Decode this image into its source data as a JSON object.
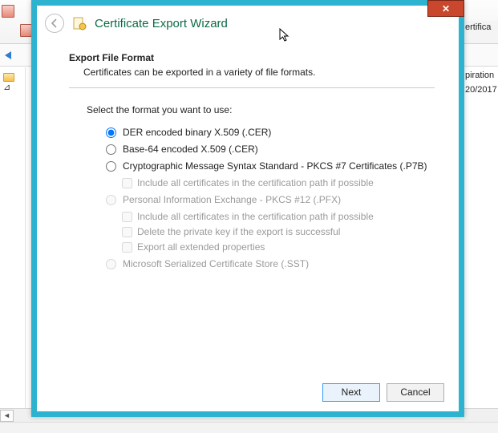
{
  "background": {
    "column_header": "ertifica",
    "column_header2": "piration",
    "date_cell": "20/2017",
    "tree_marker": "⊿"
  },
  "wizard": {
    "title": "Certificate Export Wizard",
    "section_title": "Export File Format",
    "section_subtitle": "Certificates can be exported in a variety of file formats.",
    "prompt": "Select the format you want to use:",
    "options": {
      "der": "DER encoded binary X.509 (.CER)",
      "base64": "Base-64 encoded X.509 (.CER)",
      "p7b": "Cryptographic Message Syntax Standard - PKCS #7 Certificates (.P7B)",
      "p7b_include": "Include all certificates in the certification path if possible",
      "pfx": "Personal Information Exchange - PKCS #12 (.PFX)",
      "pfx_include": "Include all certificates in the certification path if possible",
      "pfx_delete": "Delete the private key if the export is successful",
      "pfx_ext": "Export all extended properties",
      "sst": "Microsoft Serialized Certificate Store (.SST)"
    },
    "buttons": {
      "next": "Next",
      "cancel": "Cancel"
    },
    "close_glyph": "✕"
  }
}
